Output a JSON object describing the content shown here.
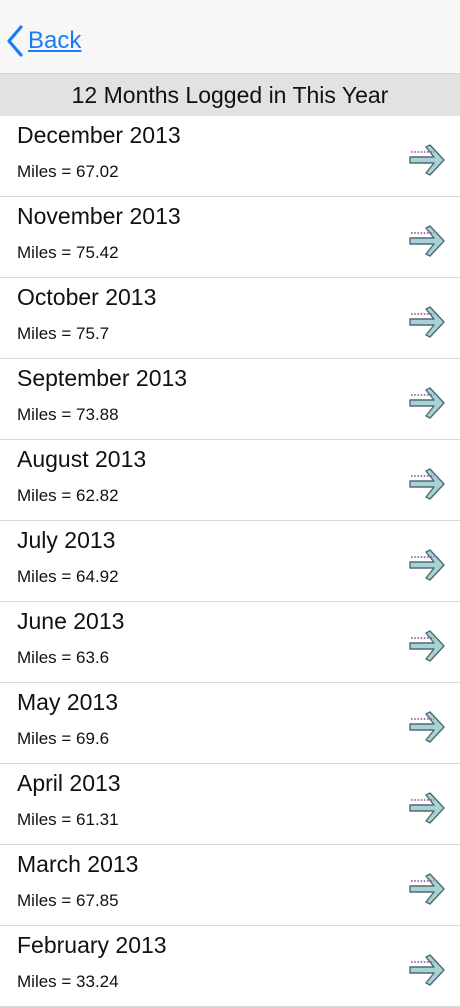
{
  "nav": {
    "back_label": "Back"
  },
  "section": {
    "title": "12 Months Logged in This Year"
  },
  "months": [
    {
      "title": "December 2013",
      "miles": "Miles = 67.02"
    },
    {
      "title": "November 2013",
      "miles": "Miles = 75.42"
    },
    {
      "title": "October 2013",
      "miles": "Miles = 75.7"
    },
    {
      "title": "September 2013",
      "miles": "Miles = 73.88"
    },
    {
      "title": "August 2013",
      "miles": "Miles = 62.82"
    },
    {
      "title": "July 2013",
      "miles": "Miles = 64.92"
    },
    {
      "title": "June 2013",
      "miles": "Miles = 63.6"
    },
    {
      "title": "May 2013",
      "miles": "Miles = 69.6"
    },
    {
      "title": "April 2013",
      "miles": "Miles = 61.31"
    },
    {
      "title": "March 2013",
      "miles": "Miles = 67.85"
    },
    {
      "title": "February 2013",
      "miles": "Miles = 33.24"
    }
  ],
  "colors": {
    "accent": "#1a7cf5",
    "arrow_fill": "#a9d2d6",
    "arrow_stroke": "#4d6b73",
    "arrow_dots": "#8a4f9e"
  },
  "icons": {
    "back": "chevron-left-icon",
    "row": "arrow-right-icon"
  }
}
